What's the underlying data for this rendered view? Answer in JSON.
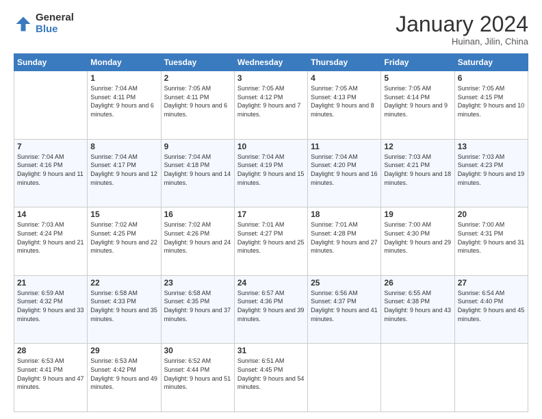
{
  "header": {
    "logo_general": "General",
    "logo_blue": "Blue",
    "month_title": "January 2024",
    "subtitle": "Huinan, Jilin, China"
  },
  "days_of_week": [
    "Sunday",
    "Monday",
    "Tuesday",
    "Wednesday",
    "Thursday",
    "Friday",
    "Saturday"
  ],
  "weeks": [
    [
      {
        "day": "",
        "sunrise": "",
        "sunset": "",
        "daylight": ""
      },
      {
        "day": "1",
        "sunrise": "Sunrise: 7:04 AM",
        "sunset": "Sunset: 4:11 PM",
        "daylight": "Daylight: 9 hours and 6 minutes."
      },
      {
        "day": "2",
        "sunrise": "Sunrise: 7:05 AM",
        "sunset": "Sunset: 4:11 PM",
        "daylight": "Daylight: 9 hours and 6 minutes."
      },
      {
        "day": "3",
        "sunrise": "Sunrise: 7:05 AM",
        "sunset": "Sunset: 4:12 PM",
        "daylight": "Daylight: 9 hours and 7 minutes."
      },
      {
        "day": "4",
        "sunrise": "Sunrise: 7:05 AM",
        "sunset": "Sunset: 4:13 PM",
        "daylight": "Daylight: 9 hours and 8 minutes."
      },
      {
        "day": "5",
        "sunrise": "Sunrise: 7:05 AM",
        "sunset": "Sunset: 4:14 PM",
        "daylight": "Daylight: 9 hours and 9 minutes."
      },
      {
        "day": "6",
        "sunrise": "Sunrise: 7:05 AM",
        "sunset": "Sunset: 4:15 PM",
        "daylight": "Daylight: 9 hours and 10 minutes."
      }
    ],
    [
      {
        "day": "7",
        "sunrise": "Sunrise: 7:04 AM",
        "sunset": "Sunset: 4:16 PM",
        "daylight": "Daylight: 9 hours and 11 minutes."
      },
      {
        "day": "8",
        "sunrise": "Sunrise: 7:04 AM",
        "sunset": "Sunset: 4:17 PM",
        "daylight": "Daylight: 9 hours and 12 minutes."
      },
      {
        "day": "9",
        "sunrise": "Sunrise: 7:04 AM",
        "sunset": "Sunset: 4:18 PM",
        "daylight": "Daylight: 9 hours and 14 minutes."
      },
      {
        "day": "10",
        "sunrise": "Sunrise: 7:04 AM",
        "sunset": "Sunset: 4:19 PM",
        "daylight": "Daylight: 9 hours and 15 minutes."
      },
      {
        "day": "11",
        "sunrise": "Sunrise: 7:04 AM",
        "sunset": "Sunset: 4:20 PM",
        "daylight": "Daylight: 9 hours and 16 minutes."
      },
      {
        "day": "12",
        "sunrise": "Sunrise: 7:03 AM",
        "sunset": "Sunset: 4:21 PM",
        "daylight": "Daylight: 9 hours and 18 minutes."
      },
      {
        "day": "13",
        "sunrise": "Sunrise: 7:03 AM",
        "sunset": "Sunset: 4:23 PM",
        "daylight": "Daylight: 9 hours and 19 minutes."
      }
    ],
    [
      {
        "day": "14",
        "sunrise": "Sunrise: 7:03 AM",
        "sunset": "Sunset: 4:24 PM",
        "daylight": "Daylight: 9 hours and 21 minutes."
      },
      {
        "day": "15",
        "sunrise": "Sunrise: 7:02 AM",
        "sunset": "Sunset: 4:25 PM",
        "daylight": "Daylight: 9 hours and 22 minutes."
      },
      {
        "day": "16",
        "sunrise": "Sunrise: 7:02 AM",
        "sunset": "Sunset: 4:26 PM",
        "daylight": "Daylight: 9 hours and 24 minutes."
      },
      {
        "day": "17",
        "sunrise": "Sunrise: 7:01 AM",
        "sunset": "Sunset: 4:27 PM",
        "daylight": "Daylight: 9 hours and 25 minutes."
      },
      {
        "day": "18",
        "sunrise": "Sunrise: 7:01 AM",
        "sunset": "Sunset: 4:28 PM",
        "daylight": "Daylight: 9 hours and 27 minutes."
      },
      {
        "day": "19",
        "sunrise": "Sunrise: 7:00 AM",
        "sunset": "Sunset: 4:30 PM",
        "daylight": "Daylight: 9 hours and 29 minutes."
      },
      {
        "day": "20",
        "sunrise": "Sunrise: 7:00 AM",
        "sunset": "Sunset: 4:31 PM",
        "daylight": "Daylight: 9 hours and 31 minutes."
      }
    ],
    [
      {
        "day": "21",
        "sunrise": "Sunrise: 6:59 AM",
        "sunset": "Sunset: 4:32 PM",
        "daylight": "Daylight: 9 hours and 33 minutes."
      },
      {
        "day": "22",
        "sunrise": "Sunrise: 6:58 AM",
        "sunset": "Sunset: 4:33 PM",
        "daylight": "Daylight: 9 hours and 35 minutes."
      },
      {
        "day": "23",
        "sunrise": "Sunrise: 6:58 AM",
        "sunset": "Sunset: 4:35 PM",
        "daylight": "Daylight: 9 hours and 37 minutes."
      },
      {
        "day": "24",
        "sunrise": "Sunrise: 6:57 AM",
        "sunset": "Sunset: 4:36 PM",
        "daylight": "Daylight: 9 hours and 39 minutes."
      },
      {
        "day": "25",
        "sunrise": "Sunrise: 6:56 AM",
        "sunset": "Sunset: 4:37 PM",
        "daylight": "Daylight: 9 hours and 41 minutes."
      },
      {
        "day": "26",
        "sunrise": "Sunrise: 6:55 AM",
        "sunset": "Sunset: 4:38 PM",
        "daylight": "Daylight: 9 hours and 43 minutes."
      },
      {
        "day": "27",
        "sunrise": "Sunrise: 6:54 AM",
        "sunset": "Sunset: 4:40 PM",
        "daylight": "Daylight: 9 hours and 45 minutes."
      }
    ],
    [
      {
        "day": "28",
        "sunrise": "Sunrise: 6:53 AM",
        "sunset": "Sunset: 4:41 PM",
        "daylight": "Daylight: 9 hours and 47 minutes."
      },
      {
        "day": "29",
        "sunrise": "Sunrise: 6:53 AM",
        "sunset": "Sunset: 4:42 PM",
        "daylight": "Daylight: 9 hours and 49 minutes."
      },
      {
        "day": "30",
        "sunrise": "Sunrise: 6:52 AM",
        "sunset": "Sunset: 4:44 PM",
        "daylight": "Daylight: 9 hours and 51 minutes."
      },
      {
        "day": "31",
        "sunrise": "Sunrise: 6:51 AM",
        "sunset": "Sunset: 4:45 PM",
        "daylight": "Daylight: 9 hours and 54 minutes."
      },
      {
        "day": "",
        "sunrise": "",
        "sunset": "",
        "daylight": ""
      },
      {
        "day": "",
        "sunrise": "",
        "sunset": "",
        "daylight": ""
      },
      {
        "day": "",
        "sunrise": "",
        "sunset": "",
        "daylight": ""
      }
    ]
  ]
}
